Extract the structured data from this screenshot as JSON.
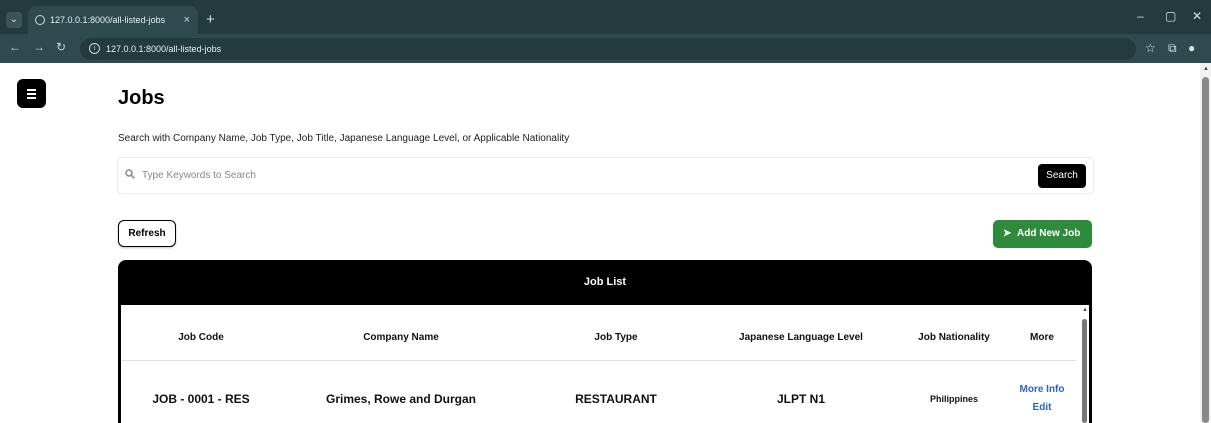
{
  "browser": {
    "tab_title": "127.0.0.1:8000/all-listed-jobs",
    "tab_close": "×",
    "new_tab": "+",
    "url": "127.0.0.1:8000/all-listed-jobs",
    "window_controls": [
      "–",
      "▢",
      "✕"
    ]
  },
  "page": {
    "title": "Jobs",
    "search_hint": "Search with Company Name, Job Type, Job Title, Japanese Language Level, or Applicable Nationality",
    "search_placeholder": "Type Keywords to Search",
    "search_button": "Search",
    "refresh_button": "Refresh",
    "add_button": "Add New Job",
    "accent_color": "#2e8b3b",
    "link_color": "#2f62c7"
  },
  "table": {
    "title": "Job List",
    "columns": [
      "Job Code",
      "Company Name",
      "Job Type",
      "Japanese Language Level",
      "Job Nationality",
      "More"
    ],
    "rows": [
      {
        "job_code": "JOB - 0001 - RES",
        "company": "Grimes, Rowe and Durgan",
        "job_type": "RESTAURANT",
        "language_level": "JLPT N1",
        "nationality": "Philippines",
        "more_info": "More Info",
        "edit": "Edit"
      }
    ]
  }
}
